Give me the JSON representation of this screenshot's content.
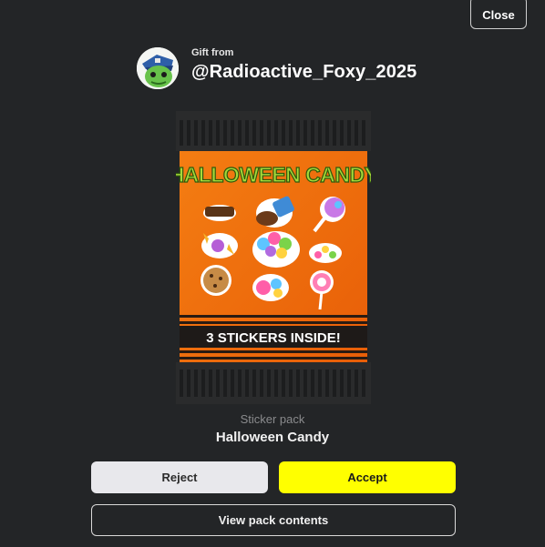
{
  "dialog": {
    "close_label": "Close",
    "gift_from_label": "Gift from",
    "sender_username": "@Radioactive_Foxy_2025",
    "pack": {
      "art_title": "HALLOWEEN CANDY",
      "art_banner": "3 STICKERS INSIDE!",
      "type_label": "Sticker pack",
      "name": "Halloween Candy"
    },
    "reject_label": "Reject",
    "accept_label": "Accept",
    "view_contents_label": "View pack contents"
  },
  "colors": {
    "background": "#232527",
    "accept": "#ffff00",
    "reject": "#e8e8ec",
    "pack_orange": "#f26a0c",
    "title_green": "#a6d93a"
  }
}
